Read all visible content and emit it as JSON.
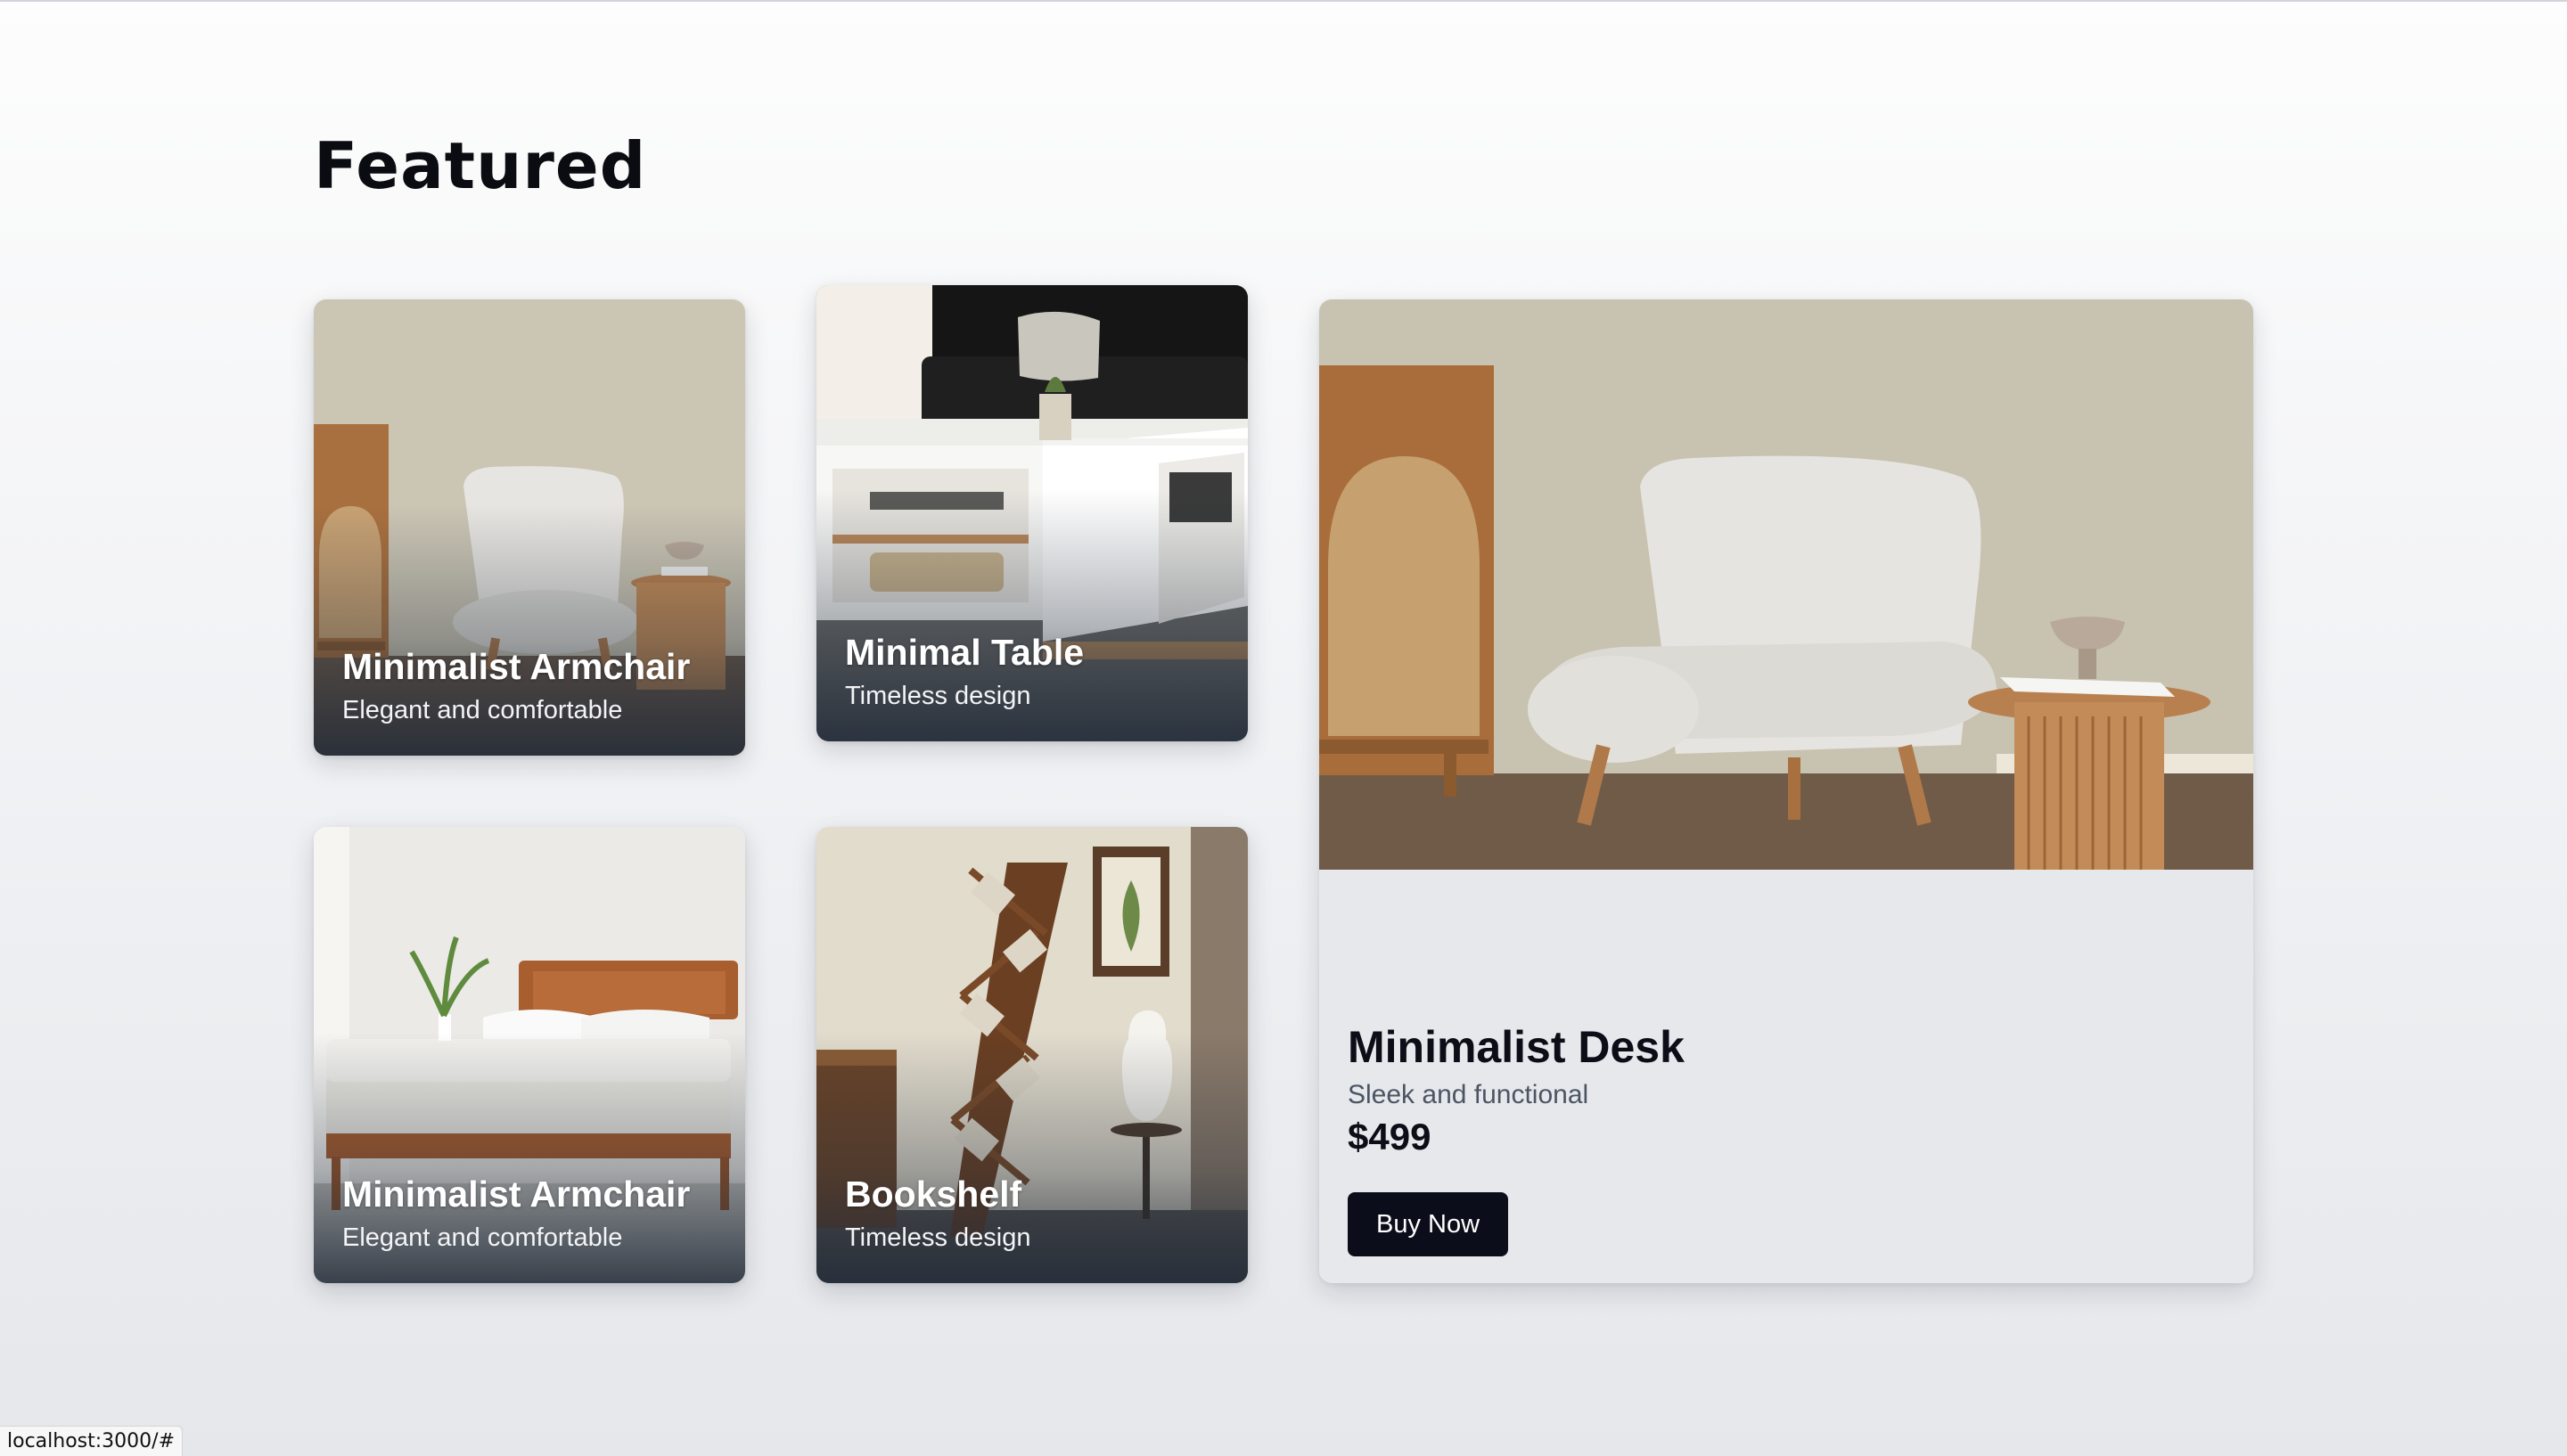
{
  "page": {
    "title": "Featured"
  },
  "cards": [
    {
      "title": "Minimalist Armchair",
      "subtitle": "Elegant and comfortable",
      "image": "armchair-photo"
    },
    {
      "title": "Minimal Table",
      "subtitle": "Timeless design",
      "image": "coffee-table-photo"
    },
    {
      "title": "Minimalist Armchair",
      "subtitle": "Elegant and comfortable",
      "image": "bed-photo"
    },
    {
      "title": "Bookshelf",
      "subtitle": "Timeless design",
      "image": "bookshelf-photo"
    }
  ],
  "feature": {
    "title": "Minimalist Desk",
    "subtitle": "Sleek and functional",
    "price": "$499",
    "button_label": "Buy Now",
    "image": "armchair-photo"
  },
  "status_bar": {
    "url": "localhost:3000/#"
  },
  "colors": {
    "text_dark": "#0b0d17",
    "button_bg": "#0b0d1a",
    "subtitle_muted": "#4b5563",
    "card_overlay": "#1f2937"
  }
}
